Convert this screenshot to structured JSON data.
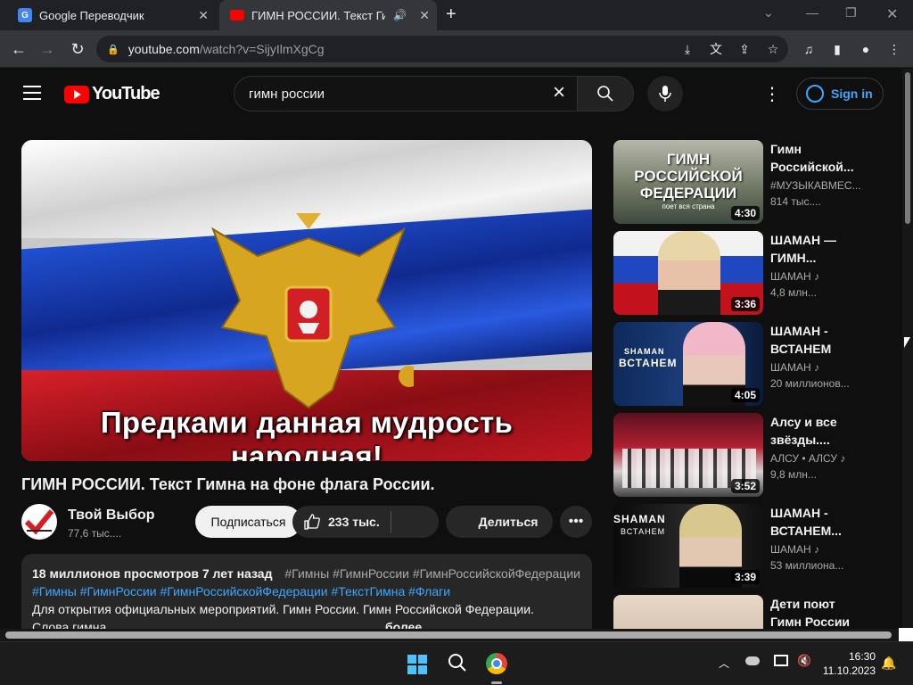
{
  "browser": {
    "tabs": [
      {
        "title": "Google Переводчик",
        "active": false
      },
      {
        "title": "ГИМН РОССИИ. Текст Гимн",
        "active": true
      }
    ],
    "url_host": "youtube.com",
    "url_path": "/watch?v=SijyIlmXgCg"
  },
  "youtube": {
    "logo_text": "YouTube",
    "search_query": "гимн россии",
    "signin_label": "Sign in",
    "video": {
      "caption": "Предками данная мудрость народная!",
      "title": "ГИМН РОССИИ. Текст Гимна на фоне флага России.",
      "channel": "Твой Выбор",
      "subscribers": "77,6 тыс....",
      "subscribe_label": "Подписаться",
      "likes": "233 тыс.",
      "share_label": "Делиться",
      "description": {
        "views_line": "18 миллионов просмотров 7 лет назад",
        "tags_inline": "#Гимны #ГимнРоссии #ГимнРоссийскойФедерации",
        "tags_line": "#Гимны #ГимнРоссии #ГимнРоссийскойФедерации #ТекстГимна #Флаги",
        "text_line": "Для открытия официальных мероприятий. Гимн России. Гимн Российской Федерации.",
        "text_line2": "Слова гимна",
        "more_label": "более"
      }
    },
    "recommendations": [
      {
        "title_1": "Гимн",
        "title_2": "Российской...",
        "channel": "#МУЗЫКАВМЕС...",
        "views": "814 тыс....",
        "duration": "4:30",
        "thumb_text": "ГИМН РОССИЙСКОЙ ФЕДЕРАЦИИ",
        "thumb_sub": "поет вся страна"
      },
      {
        "title_1": "ШАМАН —",
        "title_2": "ГИМН...",
        "channel": "ШАМАН ♪",
        "views": "4,8 млн...",
        "duration": "3:36"
      },
      {
        "title_1": "ШАМАН -",
        "title_2": "ВСТАНЕМ",
        "channel": "ШАМАН ♪",
        "views": "20 миллионов...",
        "duration": "4:05",
        "thumb_text": "SHAMAN",
        "thumb_sub": "ВСТАНЕМ"
      },
      {
        "title_1": "Алсу и все",
        "title_2": "звёзды....",
        "channel": "АЛСУ • АЛСУ ♪",
        "views": "9,8 млн...",
        "duration": "3:52"
      },
      {
        "title_1": "ШАМАН -",
        "title_2": "ВСТАНЕМ...",
        "channel": "ШАМАН ♪",
        "views": "53 миллиона...",
        "duration": "3:39",
        "thumb_text": "SHAMAN",
        "thumb_sub": "ВСТАНЕМ"
      },
      {
        "title_1": "Дети поют",
        "title_2": "Гимн России",
        "channel": "",
        "views": "",
        "duration": ""
      }
    ]
  },
  "taskbar": {
    "time": "16:30",
    "date": "11.10.2023"
  },
  "colors": {
    "youtube_red": "#ff0000",
    "link_blue": "#3ea6ff",
    "flag_white": "#f2f2f2",
    "flag_blue": "#1a3fb5",
    "flag_red": "#c8141e"
  }
}
